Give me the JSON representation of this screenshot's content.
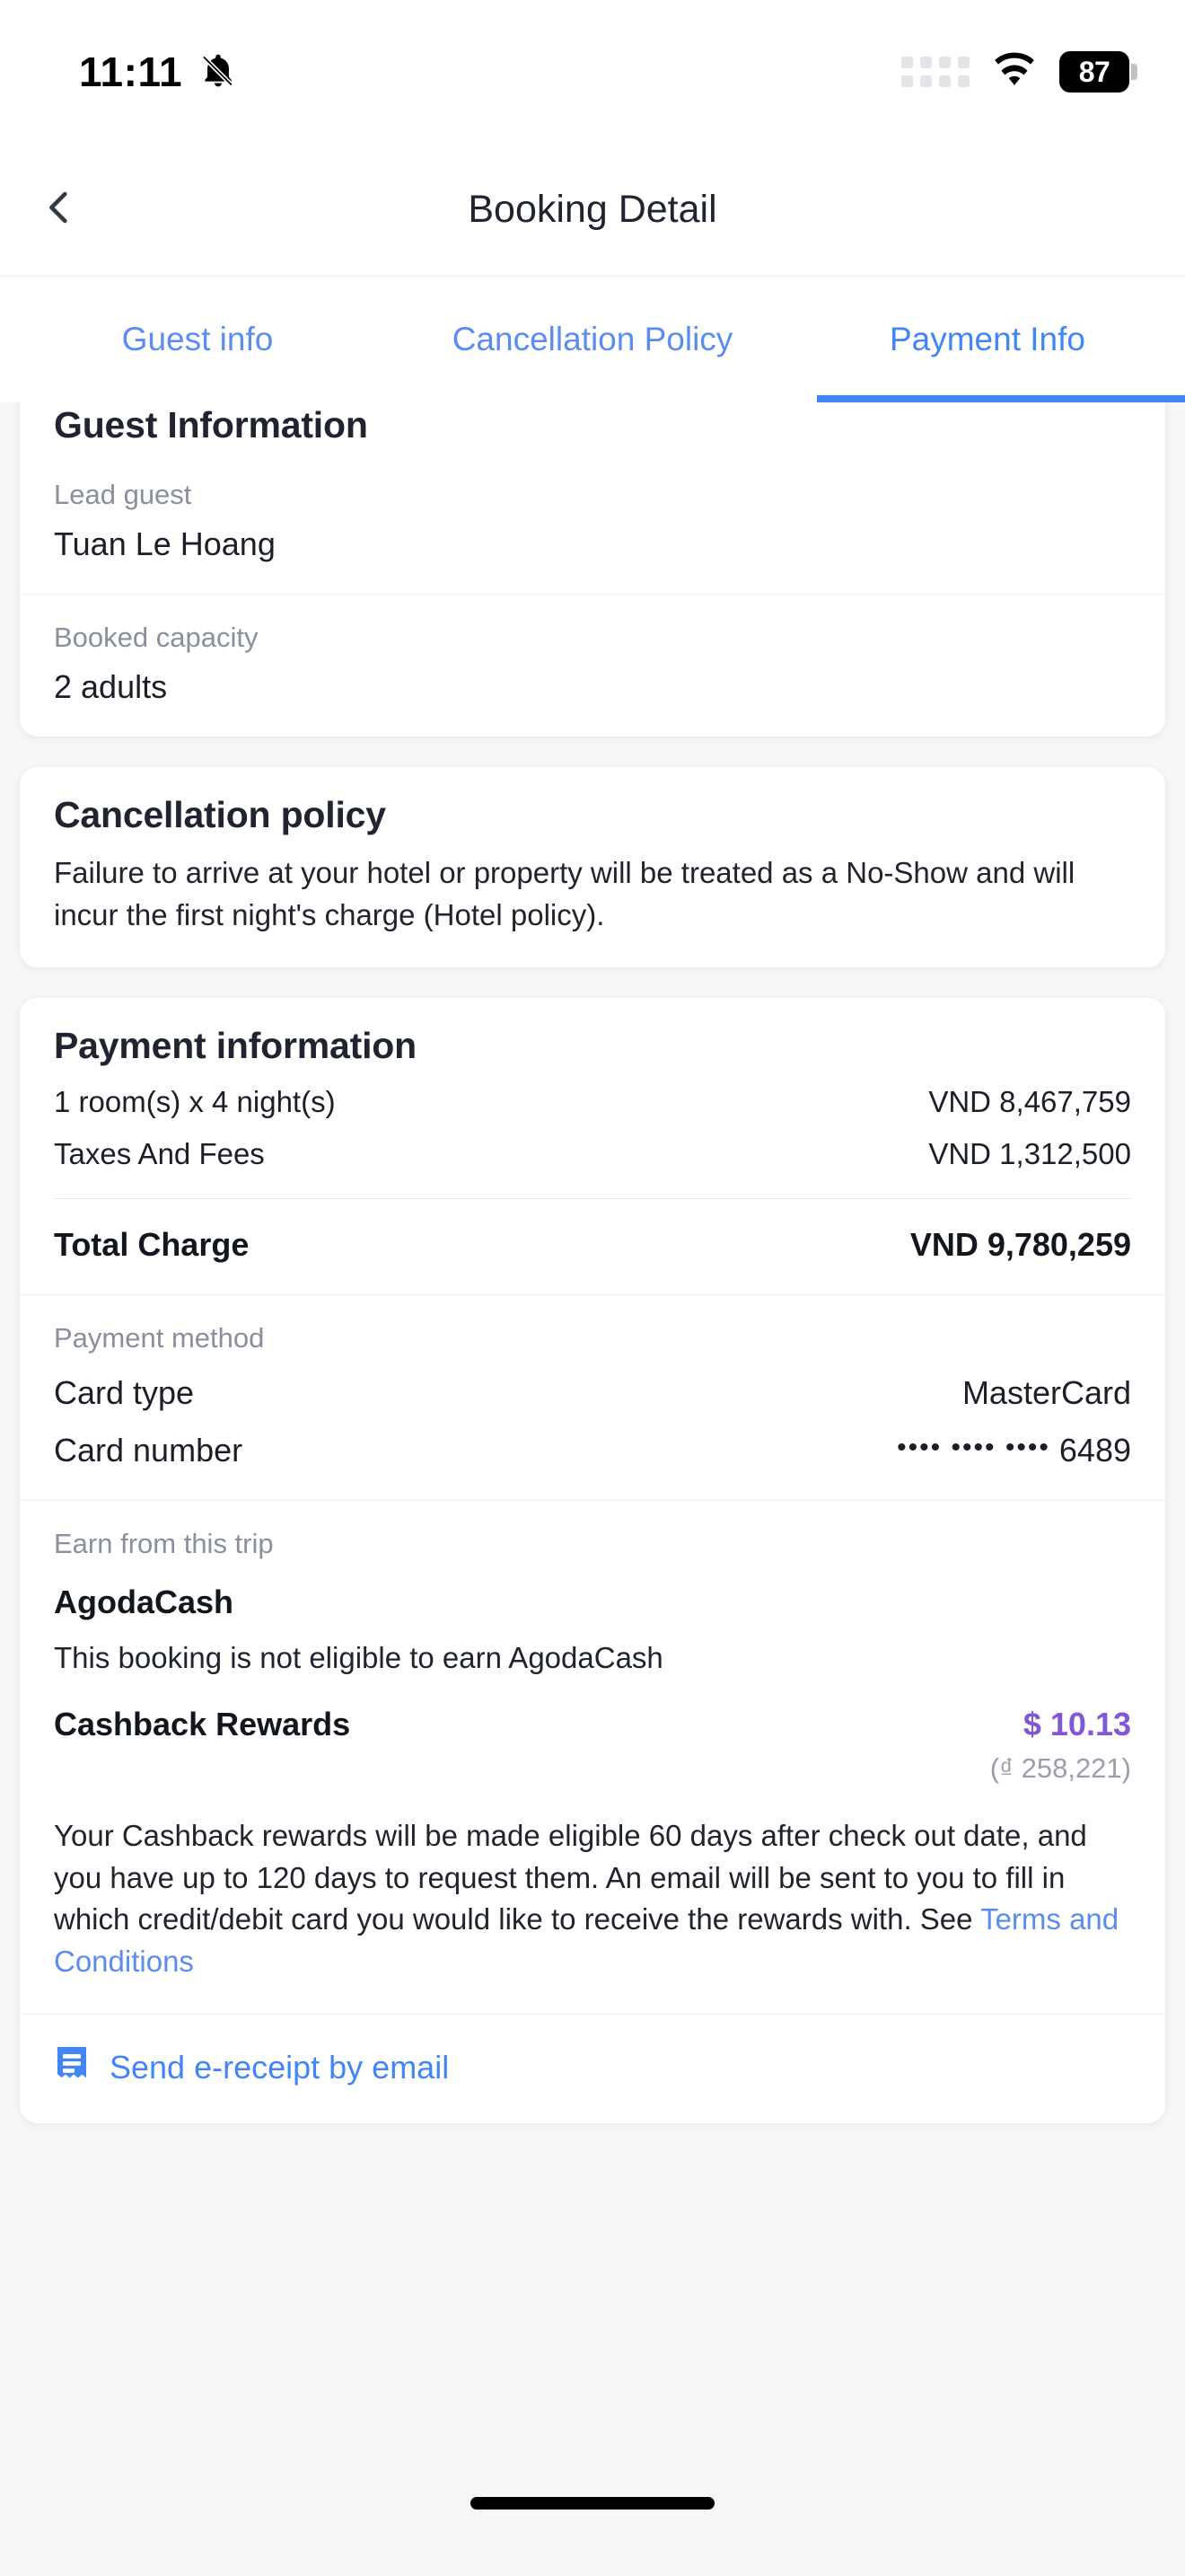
{
  "status_bar": {
    "time": "11:11",
    "bell_icon": "bell-muted-icon",
    "signal_icon": "signal-dots-icon",
    "wifi_icon": "wifi-icon",
    "battery_level": "87"
  },
  "nav": {
    "back_icon": "chevron-left-icon",
    "title": "Booking Detail"
  },
  "tabs": [
    {
      "label": "Guest info",
      "active": false
    },
    {
      "label": "Cancellation Policy",
      "active": false
    },
    {
      "label": "Payment Info",
      "active": true
    }
  ],
  "guest_card": {
    "title": "Guest Information",
    "lead_guest_label": "Lead guest",
    "lead_guest_value": "Tuan Le Hoang",
    "capacity_label": "Booked capacity",
    "capacity_value": "2 adults"
  },
  "cancellation_card": {
    "title": "Cancellation policy",
    "body": "Failure to arrive at your hotel or property will be treated as a No-Show and will incur the first night's charge (Hotel policy)."
  },
  "payment_card": {
    "title": "Payment information",
    "line_items": [
      {
        "label": "1 room(s) x 4 night(s)",
        "amount": "VND 8,467,759"
      },
      {
        "label": "Taxes And Fees",
        "amount": "VND 1,312,500"
      }
    ],
    "total_label": "Total Charge",
    "total_amount": "VND 9,780,259",
    "method_label": "Payment method",
    "card_type_label": "Card type",
    "card_type_value": "MasterCard",
    "card_number_label": "Card number",
    "card_number_masked": "•••• •••• ••••",
    "card_number_last4": "6489"
  },
  "rewards_card": {
    "section_label": "Earn from this trip",
    "agodacash_title": "AgodaCash",
    "agodacash_note": "This booking is not eligible to earn AgodaCash",
    "cashback_label": "Cashback Rewards",
    "cashback_usd": "$ 10.13",
    "cashback_vnd": "(₫ 258,221)",
    "terms_text": "Your Cashback rewards will be made eligible 60 days after check out date, and you have up to 120 days to request them. An email will be sent to you to fill in which credit/debit card you would like to receive the rewards with. See ",
    "terms_link": "Terms and Conditions"
  },
  "ereceipt": {
    "icon": "receipt-icon",
    "label": "Send e-receipt by email"
  },
  "colors": {
    "accent_blue": "#4285f4",
    "link_blue": "#5b8def",
    "purple": "#8256d8",
    "muted_grey": "#8a8f9c",
    "page_bg": "#f6f7f9"
  }
}
